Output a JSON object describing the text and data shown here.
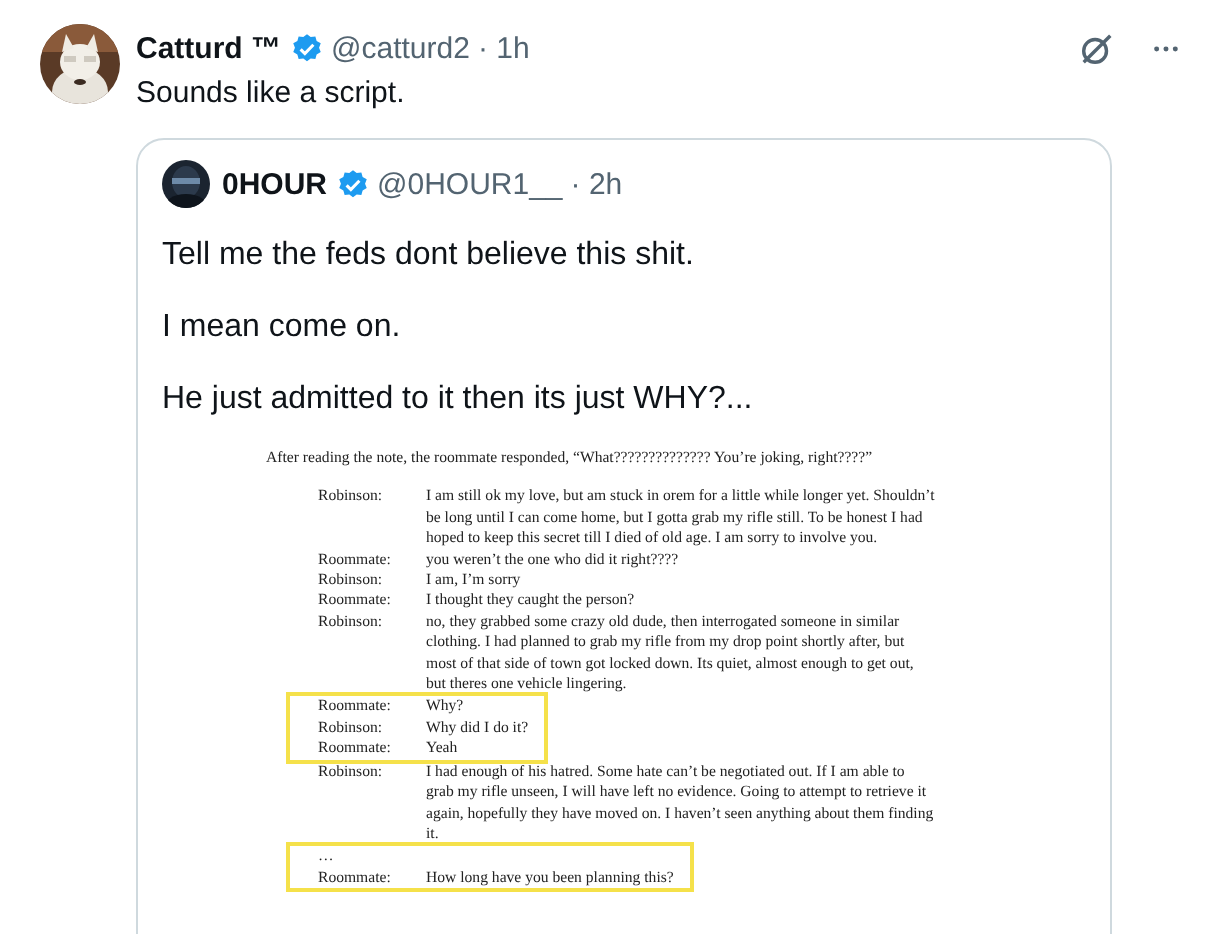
{
  "post": {
    "author": "Catturd ™",
    "verified": true,
    "handle": "@catturd2",
    "time": "· 1h",
    "text": "Sounds like a script.",
    "quote": {
      "author": "0HOUR",
      "verified": true,
      "handle": "@0HOUR1__",
      "time": "· 2h",
      "paragraphs": [
        "Tell me the feds dont believe this shit.",
        "I mean come on.",
        "He just admitted to it then its just WHY?..."
      ],
      "document": {
        "intro": "After reading the note, the roommate responded, “What?????????????? You’re joking, right????”",
        "rows": [
          {
            "kind": "line",
            "highlight": false,
            "speaker": "Robinson:",
            "text": "I am still ok my love, but am stuck in orem for a little while longer yet. Shouldn’t be long until I can come home, but I gotta grab my rifle still. To be honest I had hoped to keep this secret till I died of old age. I am sorry to involve you."
          },
          {
            "kind": "line",
            "highlight": false,
            "speaker": "Roommate:",
            "text": "you weren’t the one who did it right????"
          },
          {
            "kind": "line",
            "highlight": false,
            "speaker": "Robinson:",
            "text": "I am, I’m sorry"
          },
          {
            "kind": "line",
            "highlight": false,
            "speaker": "Roommate:",
            "text": "I thought they caught the person?"
          },
          {
            "kind": "line",
            "highlight": false,
            "speaker": "Robinson:",
            "text": "no, they grabbed some crazy old dude, then interrogated someone in similar clothing. I had planned to grab my rifle from my drop point shortly after, but most of that side of town got locked down. Its quiet, almost enough to get out, but theres one vehicle lingering."
          },
          {
            "kind": "line",
            "highlight": true,
            "speaker": "Roommate:",
            "text": "Why?"
          },
          {
            "kind": "line",
            "highlight": true,
            "speaker": "Robinson:",
            "text": "Why did I do it?"
          },
          {
            "kind": "line",
            "highlight": true,
            "speaker": "Roommate:",
            "text": "Yeah"
          },
          {
            "kind": "line",
            "highlight": false,
            "speaker": "Robinson:",
            "text": "I had enough of his hatred. Some hate can’t be negotiated out. If I am able to grab my rifle unseen, I will have left no evidence. Going to attempt to retrieve it again, hopefully they have moved on. I haven’t seen anything about them finding it."
          },
          {
            "kind": "ellipsis",
            "highlight": true,
            "text": "…"
          },
          {
            "kind": "line",
            "highlight": true,
            "speaker": "Roommate:",
            "text": "How long have you been planning this?"
          }
        ]
      }
    }
  }
}
